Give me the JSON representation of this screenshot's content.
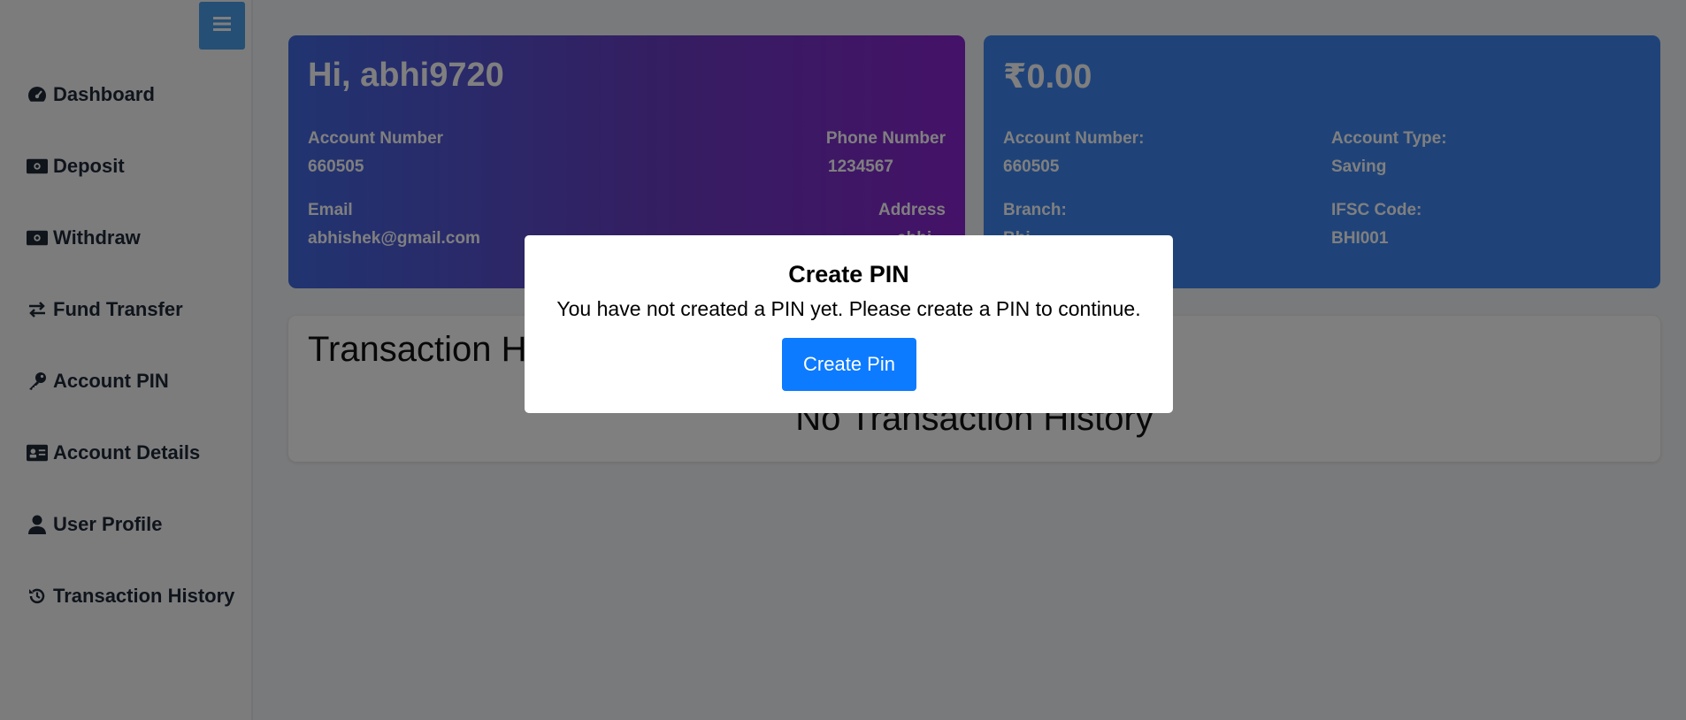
{
  "sidebar": {
    "items": [
      {
        "label": "Dashboard",
        "icon": "dashboard-gauge-icon"
      },
      {
        "label": "Deposit",
        "icon": "money-bill-icon"
      },
      {
        "label": "Withdraw",
        "icon": "money-bill-icon"
      },
      {
        "label": "Fund Transfer",
        "icon": "exchange-arrows-icon"
      },
      {
        "label": "Account PIN",
        "icon": "key-icon"
      },
      {
        "label": "Account Details",
        "icon": "id-card-icon"
      },
      {
        "label": "User Profile",
        "icon": "user-icon"
      },
      {
        "label": "Transaction History",
        "icon": "history-icon"
      }
    ]
  },
  "user_card": {
    "greeting": "Hi, abhi9720",
    "account_number_label": "Account Number",
    "account_number": "660505",
    "phone_label": "Phone Number",
    "phone": "1234567",
    "email_label": "Email",
    "email": "abhishek@gmail.com",
    "address_label": "Address",
    "address": "abhi..."
  },
  "balance_card": {
    "balance": "₹0.00",
    "account_number_label": "Account Number:",
    "account_number": "660505",
    "account_type_label": "Account Type:",
    "account_type": "Saving",
    "branch_label": "Branch:",
    "branch": "Bhi...",
    "ifsc_label": "IFSC Code:",
    "ifsc": "BHI001"
  },
  "history": {
    "title": "Transaction History",
    "empty_message": "No Transaction History"
  },
  "modal": {
    "title": "Create PIN",
    "message": "You have not created a PIN yet. Please create a PIN to continue.",
    "button_label": "Create Pin"
  },
  "colors": {
    "user_card_gradient_start": "#4169e1",
    "user_card_gradient_end": "#8a24d0",
    "balance_card": "#3f87f2",
    "primary_button": "#0d7bff",
    "sidebar_toggle": "#4a9ee8"
  }
}
